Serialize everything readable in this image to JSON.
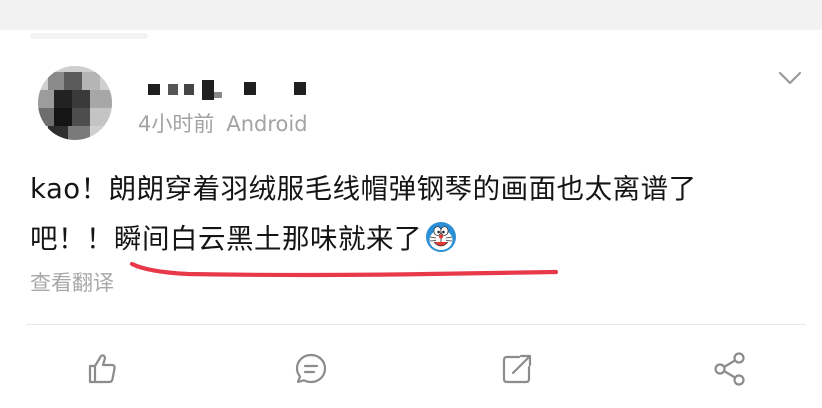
{
  "post": {
    "time": "4小时前",
    "source": "Android",
    "text_line1": "kao！朗朗穿着羽绒服毛线帽弹钢琴的画面也太离谱了",
    "text_line2": "吧！！瞬间白云黑土那味就来了",
    "emoji": "doraemon-emoji",
    "translate_label": "查看翻译"
  },
  "icons": {
    "more": "chevron-down-icon",
    "like": "thumbs-up-icon",
    "comment": "comment-icon",
    "repost": "repost-icon",
    "share": "share-icon"
  },
  "colors": {
    "text": "#151515",
    "meta": "#a3a3a3",
    "underline": "#e8394a",
    "icon": "#8c8c8c"
  }
}
